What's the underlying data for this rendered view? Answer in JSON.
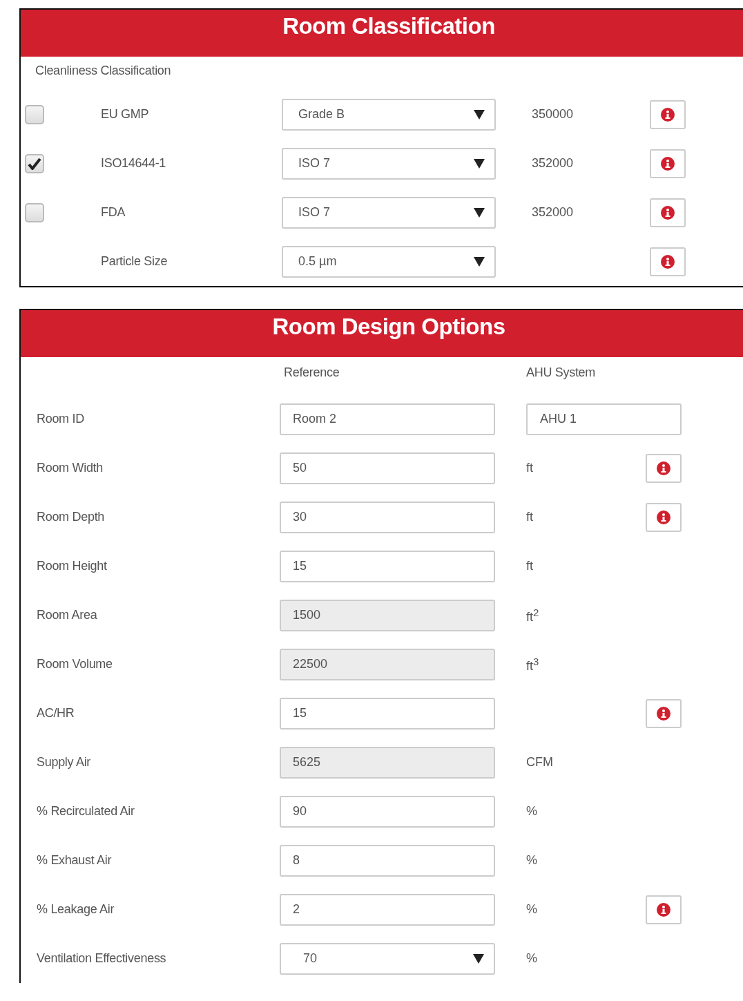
{
  "classification": {
    "title": "Room Classification",
    "subtitle": "Cleanliness Classification",
    "rows": [
      {
        "kind": "check",
        "label": "EU GMP",
        "checked": false,
        "select": "Grade B",
        "value": "350000",
        "info": true
      },
      {
        "kind": "check",
        "label": "ISO14644-1",
        "checked": true,
        "select": "ISO 7",
        "value": "352000",
        "info": true
      },
      {
        "kind": "check",
        "label": "FDA",
        "checked": false,
        "select": "ISO 7",
        "value": "352000",
        "info": true
      },
      {
        "kind": "plain",
        "label": "Particle Size",
        "select": "0.5 µm",
        "info": true
      }
    ]
  },
  "design": {
    "title": "Room Design Options",
    "columns": [
      "Reference",
      "AHU System"
    ],
    "rows": [
      {
        "label": "Room ID",
        "field": {
          "kind": "input",
          "readonly": false,
          "value": "Room 2"
        },
        "side": {
          "kind": "field",
          "text": "AHU 1"
        },
        "info": false
      },
      {
        "label": "Room Width",
        "field": {
          "kind": "input",
          "readonly": false,
          "value": "50"
        },
        "side": {
          "kind": "unit",
          "text": "ft"
        },
        "info": true
      },
      {
        "label": "Room Depth",
        "field": {
          "kind": "input",
          "readonly": false,
          "value": "30"
        },
        "side": {
          "kind": "unit",
          "text": "ft"
        },
        "info": true
      },
      {
        "label": "Room Height",
        "field": {
          "kind": "input",
          "readonly": false,
          "value": "15"
        },
        "side": {
          "kind": "unit",
          "text": "ft"
        },
        "info": false
      },
      {
        "label": "Room Area",
        "field": {
          "kind": "input",
          "readonly": true,
          "value": "1500"
        },
        "side": {
          "kind": "unit",
          "text": "ft$^{2}$"
        },
        "info": false
      },
      {
        "label": "Room Volume",
        "field": {
          "kind": "input",
          "readonly": true,
          "value": "22500"
        },
        "side": {
          "kind": "unit",
          "text": "ft$^{3}$"
        },
        "info": false
      },
      {
        "label": "AC/HR",
        "field": {
          "kind": "input",
          "readonly": false,
          "value": "15"
        },
        "info": true
      },
      {
        "label": "Supply Air",
        "field": {
          "kind": "input",
          "readonly": true,
          "value": "5625"
        },
        "side": {
          "kind": "unit",
          "text": "CFM"
        },
        "info": false
      },
      {
        "label": "% Recirculated Air",
        "field": {
          "kind": "input",
          "readonly": false,
          "value": "90"
        },
        "side": {
          "kind": "unit",
          "text": "%"
        },
        "info": false
      },
      {
        "label": "% Exhaust Air",
        "field": {
          "kind": "input",
          "readonly": false,
          "value": "8"
        },
        "side": {
          "kind": "unit",
          "text": "%"
        },
        "info": false
      },
      {
        "label": "% Leakage Air",
        "field": {
          "kind": "input",
          "readonly": false,
          "value": "2"
        },
        "side": {
          "kind": "unit",
          "text": "%"
        },
        "info": true
      },
      {
        "label": "Ventilation Effectiveness",
        "field": {
          "kind": "select",
          "value": "70"
        },
        "side": {
          "kind": "unit",
          "text": "%"
        },
        "info": false
      }
    ]
  }
}
